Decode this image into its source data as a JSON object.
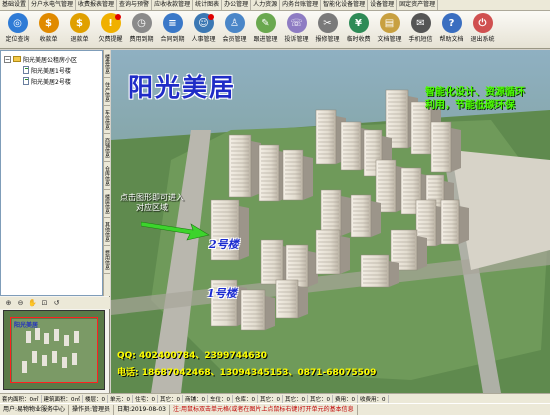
{
  "menu": [
    "基础设置",
    "分户水电气管理",
    "收费报表管理",
    "查询与预警",
    "应收收款管理",
    "统计图表",
    "办公管理",
    "人力资源",
    "内务台账管理",
    "智能化设备管理",
    "设备管理",
    "固定资产管理"
  ],
  "toolbar": [
    {
      "label": "定位查询",
      "icon": "locate-icon",
      "color": "#2f7bd6",
      "glyph": "◎"
    },
    {
      "label": "收款单",
      "icon": "coin-icon",
      "color": "#e08a00",
      "glyph": "$"
    },
    {
      "label": "退款单",
      "icon": "refund-icon",
      "color": "#e0a000",
      "glyph": "$"
    },
    {
      "label": "欠费提醒",
      "icon": "bell-icon",
      "color": "#f0b000",
      "glyph": "!",
      "red_dot": true
    },
    {
      "label": "费用到期",
      "icon": "clock-icon",
      "color": "#8a8a8a",
      "glyph": "◷"
    },
    {
      "label": "合同到期",
      "icon": "contract-icon",
      "color": "#3a78c8",
      "glyph": "≡"
    },
    {
      "label": "人事管理",
      "icon": "people-icon",
      "color": "#3c78b4",
      "glyph": "☺",
      "red_dot": true
    },
    {
      "label": "会员管理",
      "icon": "member-icon",
      "color": "#4a86c8",
      "glyph": "♙"
    },
    {
      "label": "跟进管理",
      "icon": "followup-icon",
      "color": "#6aa84f",
      "glyph": "✎"
    },
    {
      "label": "投诉管理",
      "icon": "complaint-icon",
      "color": "#8e7cc3",
      "glyph": "☏"
    },
    {
      "label": "报修管理",
      "icon": "repair-icon",
      "color": "#7a7a7a",
      "glyph": "✂"
    },
    {
      "label": "临时收费",
      "icon": "temp-fee-icon",
      "color": "#2e8b57",
      "glyph": "¥"
    },
    {
      "label": "文档管理",
      "icon": "document-icon",
      "color": "#c8a040",
      "glyph": "▤"
    },
    {
      "label": "手机短信",
      "icon": "sms-icon",
      "color": "#555555",
      "glyph": "✉"
    },
    {
      "label": "帮助文档",
      "icon": "help-icon",
      "color": "#3a6ec0",
      "glyph": "?"
    },
    {
      "label": "退出系统",
      "icon": "exit-icon",
      "color": "#d05050",
      "glyph": "⏻"
    }
  ],
  "tree": {
    "root": "阳光美居公租房小区",
    "children": [
      "阳光美居1号楼",
      "阳光美居2号楼"
    ]
  },
  "vtabs": [
    "楼盘信息",
    "住户信息",
    "车位信息",
    "商铺信息",
    "仓库信息",
    "楼层信息",
    "其他信息",
    "费用信息"
  ],
  "main": {
    "title": "阳光美居",
    "slogan_1": "智能化设计、资源循环",
    "slogan_2": "利用，节能低碳环保",
    "hint": "点击图形即可进入对应区域",
    "label_building_2": "2号楼",
    "label_building_1": "1号楼",
    "qq": "QQ: 402400784、2399744630",
    "phone": "电话: 18687042468、13094345153、0871-68075509"
  },
  "stats": [
    "套内面积：0㎡",
    "建筑面积：0㎡",
    "楼层：0",
    "单元：0",
    "住宅：0",
    "其它：0",
    "商铺：0",
    "车位：0",
    "仓库：0",
    "其它：0",
    "其它：0",
    "其它：0",
    "费用：0",
    "收费用：0"
  ],
  "status": {
    "company": "用户:易物物业服务中心",
    "operator": "操作员:管理员",
    "date": "日期:2019-08-03",
    "tip": "注:用鼠标双击单元格(或者在图片上点鼠标右键)打开单元的基本信息"
  }
}
